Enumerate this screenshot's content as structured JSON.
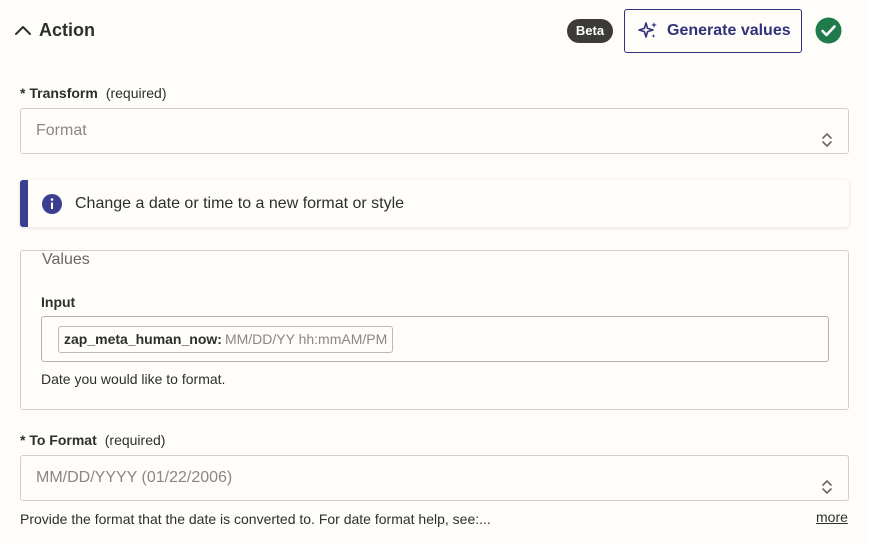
{
  "header": {
    "title": "Action",
    "beta_label": "Beta",
    "generate_label": "Generate values",
    "collapse_icon": "chevron-up-icon",
    "status_icon": "check-circle-icon",
    "status_color": "#1f7a4c"
  },
  "transform": {
    "label": "* Transform",
    "required": "(required)",
    "value": "Format"
  },
  "info": {
    "text": "Change a date or time to a new format or style",
    "accent_color": "#3c3e8f"
  },
  "values": {
    "legend": "Values",
    "input_label": "Input",
    "pill_key": "zap_meta_human_now:",
    "pill_value": "MM/DD/YY hh:mmAM/PM",
    "helper": "Date you would like to format."
  },
  "to_format": {
    "label": "* To Format",
    "required": "(required)",
    "value": "MM/DD/YYYY (01/22/2006)",
    "helper": "Provide the format that the date is converted to. For date format help, see:...",
    "more": "more"
  }
}
